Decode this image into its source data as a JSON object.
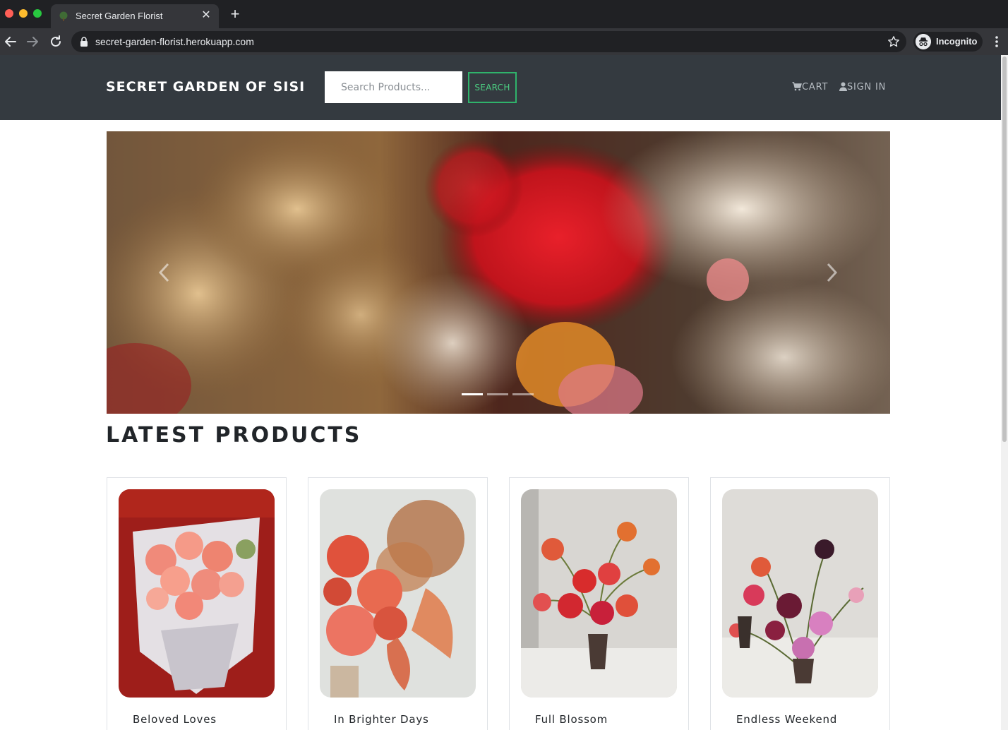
{
  "browser": {
    "tab_title": "Secret Garden Florist",
    "url": "secret-garden-florist.herokuapp.com",
    "profile_label": "Incognito"
  },
  "header": {
    "brand": "SECRET GARDEN OF SISI",
    "search": {
      "placeholder": "Search Products...",
      "value": ""
    },
    "search_button": "SEARCH",
    "cart_label": "CART",
    "signin_label": "SIGN IN"
  },
  "carousel": {
    "active_index": 0,
    "slide_count": 3,
    "image_icon": "dried-flowers-photo"
  },
  "latest": {
    "title": "LATEST PRODUCTS",
    "products": [
      {
        "name": "Beloved Loves",
        "image_icon": "pink-roses-bouquet-photo"
      },
      {
        "name": "In Brighter Days",
        "image_icon": "coral-zinnia-bouquet-photo"
      },
      {
        "name": "Full Blossom",
        "image_icon": "red-tulip-vase-photo"
      },
      {
        "name": "Endless Weekend",
        "image_icon": "pink-calla-vase-photo"
      }
    ]
  },
  "colors": {
    "header_bg": "#343a40",
    "accent_green": "#2fb36b",
    "browser_dark": "#202124"
  }
}
